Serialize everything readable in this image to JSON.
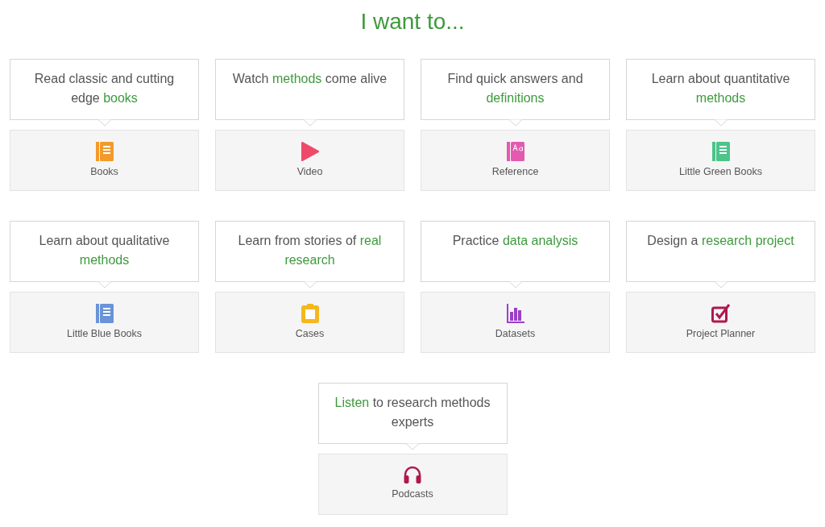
{
  "heading": "I want to...",
  "cards": [
    {
      "prompt": [
        {
          "text": "Read classic and cutting edge ",
          "highlight": false
        },
        {
          "text": "books",
          "highlight": true
        }
      ],
      "label": "Books",
      "icon": {
        "kind": "book",
        "color": "#f39a2b"
      }
    },
    {
      "prompt": [
        {
          "text": "Watch ",
          "highlight": false
        },
        {
          "text": "methods",
          "highlight": true
        },
        {
          "text": " come alive",
          "highlight": false
        }
      ],
      "label": "Video",
      "icon": {
        "kind": "play",
        "color": "#ee4a6a"
      }
    },
    {
      "prompt": [
        {
          "text": "Find quick answers and ",
          "highlight": false
        },
        {
          "text": "definitions",
          "highlight": true
        }
      ],
      "label": "Reference",
      "icon": {
        "kind": "reference",
        "color": "#e35ab0"
      }
    },
    {
      "prompt": [
        {
          "text": "Learn about quantitative ",
          "highlight": false
        },
        {
          "text": "methods",
          "highlight": true
        }
      ],
      "label": "Little Green Books",
      "icon": {
        "kind": "book",
        "color": "#4cc48a"
      }
    },
    {
      "prompt": [
        {
          "text": "Learn about qualitative ",
          "highlight": false
        },
        {
          "text": "methods",
          "highlight": true
        }
      ],
      "label": "Little Blue Books",
      "icon": {
        "kind": "book",
        "color": "#6a93d8"
      }
    },
    {
      "prompt": [
        {
          "text": "Learn from stories of ",
          "highlight": false
        },
        {
          "text": "real research",
          "highlight": true
        }
      ],
      "label": "Cases",
      "icon": {
        "kind": "clipboard",
        "color": "#f5b81c"
      }
    },
    {
      "prompt": [
        {
          "text": "Practice ",
          "highlight": false
        },
        {
          "text": "data analysis",
          "highlight": true
        }
      ],
      "label": "Datasets",
      "icon": {
        "kind": "chart",
        "color": "#9b3fc9"
      }
    },
    {
      "prompt": [
        {
          "text": "Design a ",
          "highlight": false
        },
        {
          "text": "research project",
          "highlight": true
        }
      ],
      "label": "Project Planner",
      "icon": {
        "kind": "check",
        "color": "#b0184f"
      }
    },
    {
      "prompt": [
        {
          "text": "Listen",
          "highlight": true
        },
        {
          "text": " to research methods experts",
          "highlight": false
        }
      ],
      "label": "Podcasts",
      "icon": {
        "kind": "headphones",
        "color": "#b0184f"
      }
    }
  ]
}
